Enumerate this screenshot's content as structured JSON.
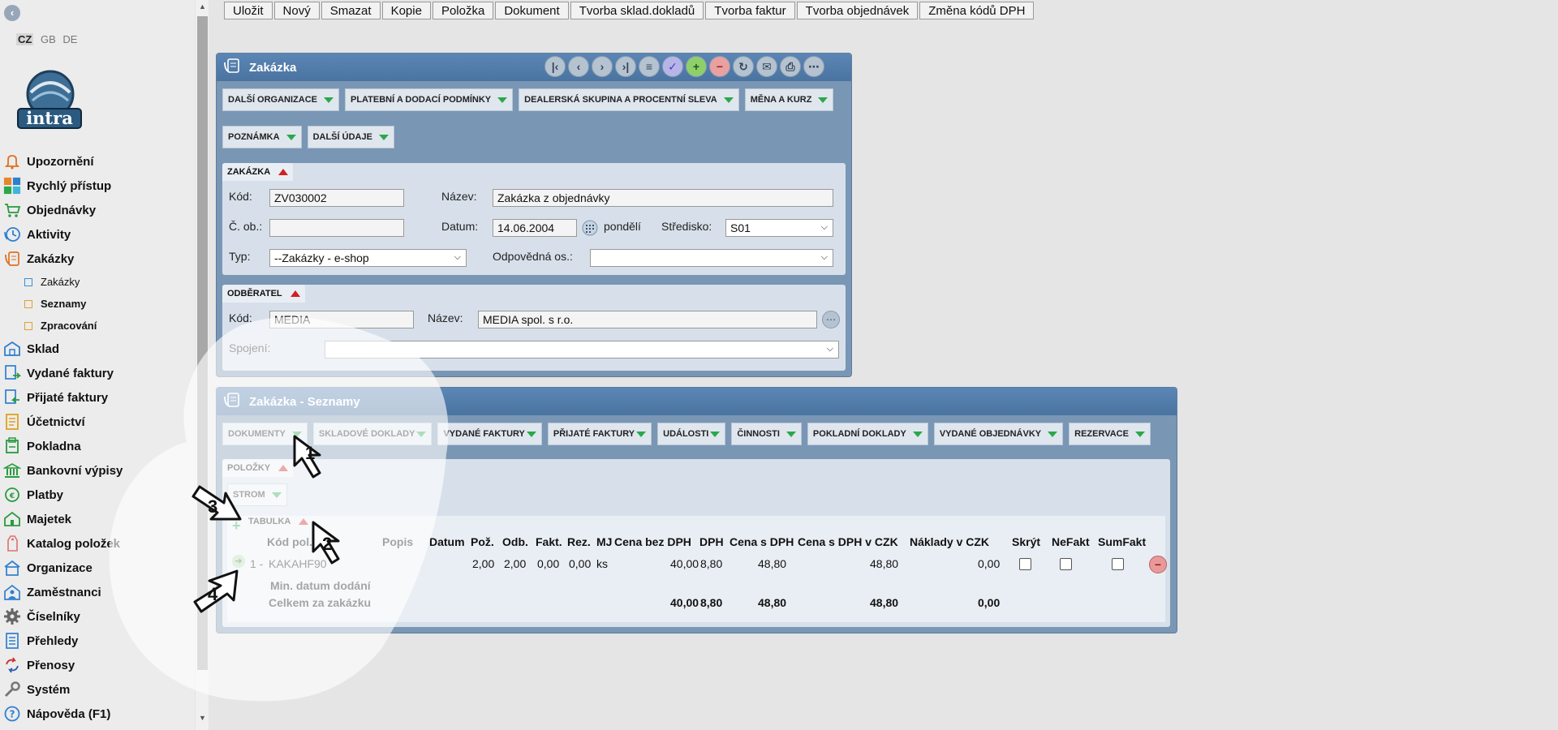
{
  "languages": [
    "CZ",
    "GB",
    "DE"
  ],
  "nav": [
    {
      "label": "Upozornění",
      "icon": "bell-icon",
      "type": "main"
    },
    {
      "label": "Rychlý přístup",
      "icon": "tiles-icon",
      "type": "main"
    },
    {
      "label": "Objednávky",
      "icon": "cart-icon",
      "type": "main"
    },
    {
      "label": "Aktivity",
      "icon": "clock-icon",
      "type": "main"
    },
    {
      "label": "Zakázky",
      "icon": "order-icon",
      "type": "main"
    },
    {
      "label": "Zakázky",
      "icon": "square-blue-icon",
      "type": "sub"
    },
    {
      "label": "Seznamy",
      "icon": "square-icon",
      "type": "sub-bold"
    },
    {
      "label": "Zpracování",
      "icon": "square-icon",
      "type": "sub-bold"
    },
    {
      "label": "Sklad",
      "icon": "warehouse-icon",
      "type": "main"
    },
    {
      "label": "Vydané faktury",
      "icon": "invoice-out-icon",
      "type": "main"
    },
    {
      "label": "Přijaté faktury",
      "icon": "invoice-in-icon",
      "type": "main"
    },
    {
      "label": "Účetnictví",
      "icon": "ledger-icon",
      "type": "main"
    },
    {
      "label": "Pokladna",
      "icon": "cashbox-icon",
      "type": "main"
    },
    {
      "label": "Bankovní výpisy",
      "icon": "bank-icon",
      "type": "main"
    },
    {
      "label": "Platby",
      "icon": "coins-icon",
      "type": "main"
    },
    {
      "label": "Majetek",
      "icon": "property-icon",
      "type": "main"
    },
    {
      "label": "Katalog položek",
      "icon": "tag-icon",
      "type": "main"
    },
    {
      "label": "Organizace",
      "icon": "building-icon",
      "type": "main"
    },
    {
      "label": "Zaměstnanci",
      "icon": "employee-icon",
      "type": "main"
    },
    {
      "label": "Číselníky",
      "icon": "gear-icon",
      "type": "main"
    },
    {
      "label": "Přehledy",
      "icon": "list-icon",
      "type": "main"
    },
    {
      "label": "Přenosy",
      "icon": "transfer-icon",
      "type": "main"
    },
    {
      "label": "Systém",
      "icon": "wrench-icon",
      "type": "main"
    },
    {
      "label": "Nápověda (F1)",
      "icon": "help-icon",
      "type": "main"
    }
  ],
  "toolbar": [
    "Uložit",
    "Nový",
    "Smazat",
    "Kopie",
    "Položka",
    "Dokument",
    "Tvorba sklad.dokladů",
    "Tvorba faktur",
    "Tvorba objednávek",
    "Změna kódů DPH"
  ],
  "zakazka_panel": {
    "title": "Zakázka",
    "tabs_row1": [
      "DALŠÍ ORGANIZACE",
      "PLATEBNÍ A DODACÍ PODMÍNKY",
      "DEALERSKÁ SKUPINA A PROCENTNÍ SLEVA",
      "MĚNA A KURZ"
    ],
    "tabs_row2": [
      "POZNÁMKA",
      "DALŠÍ ÚDAJE"
    ],
    "section_zakazka": "ZAKÁZKA",
    "kod_label": "Kód:",
    "kod_value": "ZV030002",
    "nazev_label": "Název:",
    "nazev_value": "Zakázka z objednávky",
    "cob_label": "Č. ob.:",
    "cob_value": "",
    "datum_label": "Datum:",
    "datum_value": "14.06.2004",
    "den": "pondělí",
    "stredisko_label": "Středisko:",
    "stredisko_value": "S01",
    "typ_label": "Typ:",
    "typ_value": "--Zakázky - e-shop",
    "odpov_label": "Odpovědná os.:",
    "odpov_value": "",
    "section_odberatel": "ODBĚRATEL",
    "odb_kod_label": "Kód:",
    "odb_kod_value": "MEDIA",
    "odb_nazev_label": "Název:",
    "odb_nazev_value": "MEDIA spol. s r.o.",
    "spojeni_label": "Spojení:",
    "spojeni_value": ""
  },
  "seznamy_panel": {
    "title": "Zakázka - Seznamy",
    "tabs": [
      "DOKUMENTY",
      "SKLADOVÉ DOKLADY",
      "VYDANÉ FAKTURY",
      "PŘIJATÉ FAKTURY",
      "UDÁLOSTI",
      "ČINNOSTI",
      "POKLADNÍ DOKLADY",
      "VYDANÉ OBJEDNÁVKY",
      "REZERVACE"
    ],
    "polozky": "POLOŽKY",
    "strom": "STROM",
    "tabulka": "TABULKA",
    "columns": [
      "Kód pol.",
      "Popis",
      "Datum",
      "Pož.",
      "Odb.",
      "Fakt.",
      "Rez.",
      "MJ",
      "Cena bez DPH",
      "DPH",
      "Cena s DPH",
      "Cena s DPH v CZK",
      "Náklady v CZK",
      "Skrýt",
      "NeFakt",
      "SumFakt"
    ],
    "row": {
      "num": "1 -",
      "kod": "KAKAHF90",
      "poz": "2,00",
      "odb": "2,00",
      "fakt": "0,00",
      "rez": "0,00",
      "mj": "ks",
      "cena_bez": "40,00",
      "dph": "8,80",
      "cena_s": "48,80",
      "cena_czk": "48,80",
      "naklady": "0,00"
    },
    "min_datum": "Min. datum dodání",
    "celkem": "Celkem za zakázku",
    "totals": {
      "cena_bez": "40,00",
      "dph": "8,80",
      "cena_s": "48,80",
      "cena_czk": "48,80",
      "naklady": "0,00"
    }
  },
  "markers": [
    "1",
    "2",
    "3",
    "4"
  ]
}
